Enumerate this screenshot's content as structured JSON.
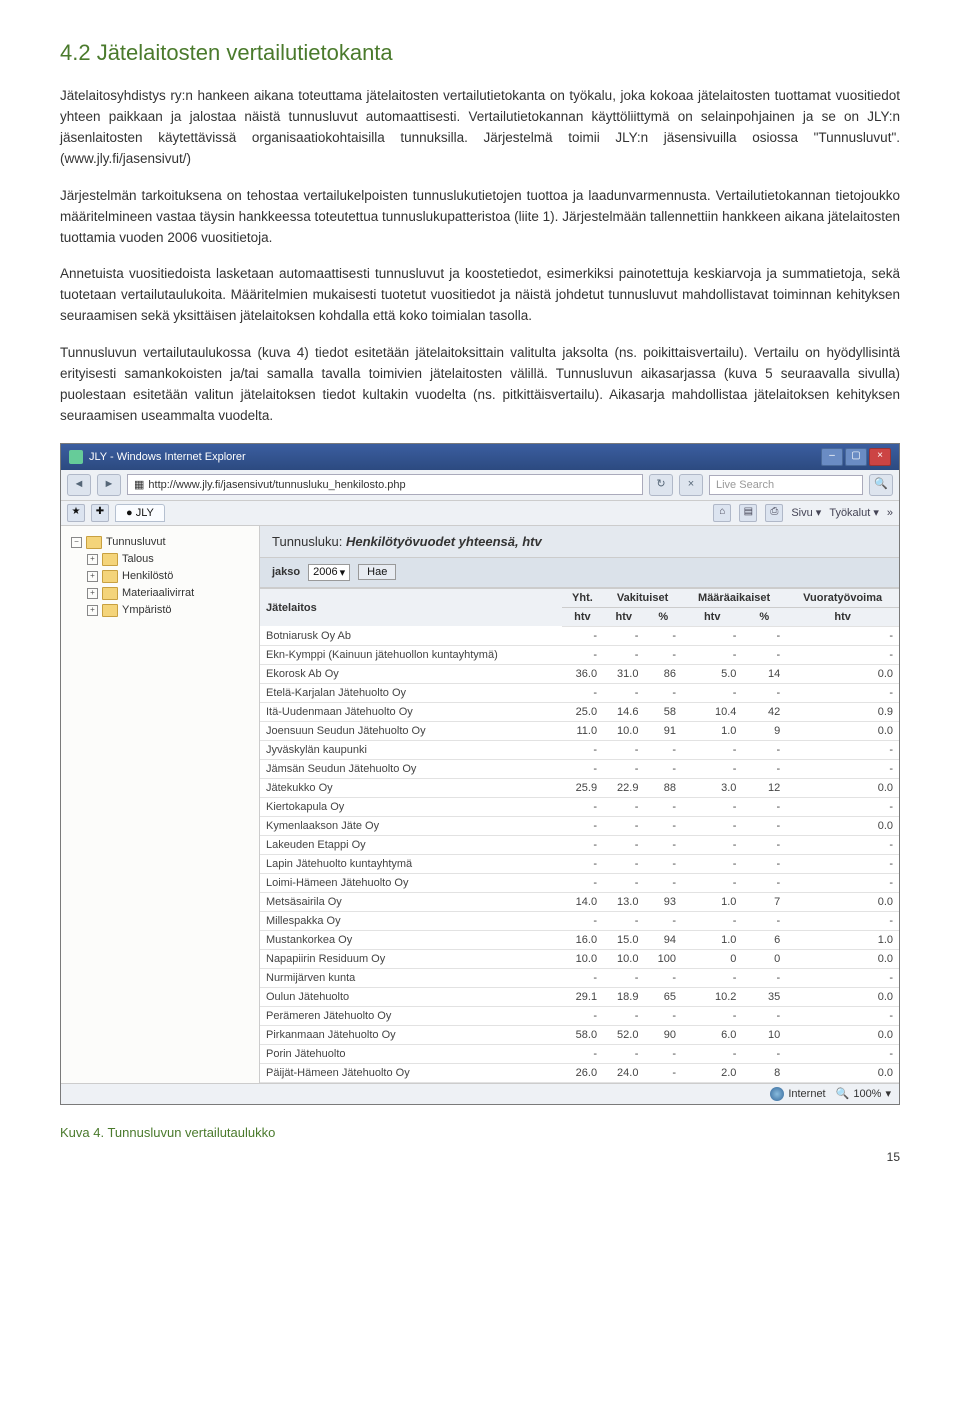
{
  "section_heading": "4.2 Jätelaitosten vertailutietokanta",
  "paragraphs": {
    "p1": "Jätelaitosyhdistys ry:n hankeen aikana toteuttama jätelaitosten vertailutietokanta on työkalu, joka kokoaa jätelaitosten tuottamat vuositiedot yhteen paikkaan ja jalostaa näistä tunnusluvut automaattisesti. Vertailutietokannan käyttöliittymä on selainpohjainen ja se on JLY:n jäsenlaitosten käytettävissä organisaatiokohtaisilla tunnuksilla. Järjestelmä toimii JLY:n jäsensivuilla osiossa \"Tunnusluvut\". (www.jly.fi/jasensivut/)",
    "p2": "Järjestelmän tarkoituksena on tehostaa vertailukelpoisten tunnuslukutietojen tuottoa ja laadunvarmennusta. Vertailutietokannan tietojoukko määritelmineen vastaa täysin hankkeessa toteutettua tunnuslukupatteristoa (liite 1). Järjestelmään tallennettiin hankkeen aikana jätelaitosten tuottamia vuoden 2006 vuositietoja.",
    "p3": "Annetuista vuositiedoista lasketaan automaattisesti tunnusluvut ja koostetiedot, esimerkiksi painotettuja keskiarvoja ja summatietoja, sekä tuotetaan vertailutaulukoita. Määritelmien mukaisesti tuotetut vuositiedot ja näistä johdetut tunnusluvut mahdollistavat toiminnan kehityksen seuraamisen sekä yksittäisen jätelaitoksen kohdalla että koko toimialan tasolla.",
    "p4": "Tunnusluvun vertailutaulukossa (kuva 4) tiedot esitetään jätelaitoksittain valitulta jaksolta (ns. poikittaisvertailu). Vertailu on hyödyllisintä erityisesti samankokoisten ja/tai samalla tavalla toimivien jätelaitosten välillä. Tunnusluvun aikasarjassa (kuva 5 seuraavalla sivulla) puolestaan esitetään valitun jätelaitoksen tiedot kultakin vuodelta (ns. pitkittäisvertailu). Aikasarja mahdollistaa jätelaitoksen kehityksen seuraamisen useammalta vuodelta."
  },
  "browser": {
    "title": "JLY - Windows Internet Explorer",
    "url": "http://www.jly.fi/jasensivut/tunnusluku_henkilosto.php",
    "search_placeholder": "Live Search",
    "tab_label": "JLY",
    "toolbar": {
      "sivu": "Sivu",
      "tyokalut": "Työkalut"
    },
    "tree": {
      "root": "Tunnusluvut",
      "items": [
        "Talous",
        "Henkilöstö",
        "Materiaalivirrat",
        "Ympäristö"
      ]
    },
    "panel": {
      "label_prefix": "Tunnusluku:",
      "label_value": "Henkilötyövuodet yhteensä, htv",
      "filter_label": "jakso",
      "year": "2006",
      "hae": "Hae"
    },
    "status": {
      "zone": "Internet",
      "zoom": "100%"
    }
  },
  "chart_data": {
    "type": "table",
    "title": "Henkilötyövuodet yhteensä, htv",
    "columns_top": [
      "",
      "Yht.",
      "Vakituiset",
      "Määräaikaiset",
      "Vuoratyövoima"
    ],
    "columns_sub": [
      "Jätelaitos",
      "htv",
      "htv",
      "%",
      "htv",
      "%",
      "htv"
    ],
    "rows": [
      {
        "name": "Botniarusk Oy Ab",
        "yht": "-",
        "vak_htv": "-",
        "vak_pct": "-",
        "maa_htv": "-",
        "maa_pct": "-",
        "vuo": "-"
      },
      {
        "name": "Ekn-Kymppi (Kainuun jätehuollon kuntayhtymä)",
        "yht": "-",
        "vak_htv": "-",
        "vak_pct": "-",
        "maa_htv": "-",
        "maa_pct": "-",
        "vuo": "-"
      },
      {
        "name": "Ekorosk Ab Oy",
        "yht": "36.0",
        "vak_htv": "31.0",
        "vak_pct": "86",
        "maa_htv": "5.0",
        "maa_pct": "14",
        "vuo": "0.0"
      },
      {
        "name": "Etelä-Karjalan Jätehuolto Oy",
        "yht": "-",
        "vak_htv": "-",
        "vak_pct": "-",
        "maa_htv": "-",
        "maa_pct": "-",
        "vuo": "-"
      },
      {
        "name": "Itä-Uudenmaan Jätehuolto Oy",
        "yht": "25.0",
        "vak_htv": "14.6",
        "vak_pct": "58",
        "maa_htv": "10.4",
        "maa_pct": "42",
        "vuo": "0.9"
      },
      {
        "name": "Joensuun Seudun Jätehuolto Oy",
        "yht": "11.0",
        "vak_htv": "10.0",
        "vak_pct": "91",
        "maa_htv": "1.0",
        "maa_pct": "9",
        "vuo": "0.0"
      },
      {
        "name": "Jyväskylän kaupunki",
        "yht": "-",
        "vak_htv": "-",
        "vak_pct": "-",
        "maa_htv": "-",
        "maa_pct": "-",
        "vuo": "-"
      },
      {
        "name": "Jämsän Seudun Jätehuolto Oy",
        "yht": "-",
        "vak_htv": "-",
        "vak_pct": "-",
        "maa_htv": "-",
        "maa_pct": "-",
        "vuo": "-"
      },
      {
        "name": "Jätekukko Oy",
        "yht": "25.9",
        "vak_htv": "22.9",
        "vak_pct": "88",
        "maa_htv": "3.0",
        "maa_pct": "12",
        "vuo": "0.0"
      },
      {
        "name": "Kiertokapula Oy",
        "yht": "-",
        "vak_htv": "-",
        "vak_pct": "-",
        "maa_htv": "-",
        "maa_pct": "-",
        "vuo": "-"
      },
      {
        "name": "Kymenlaakson Jäte Oy",
        "yht": "-",
        "vak_htv": "-",
        "vak_pct": "-",
        "maa_htv": "-",
        "maa_pct": "-",
        "vuo": "0.0"
      },
      {
        "name": "Lakeuden Etappi Oy",
        "yht": "-",
        "vak_htv": "-",
        "vak_pct": "-",
        "maa_htv": "-",
        "maa_pct": "-",
        "vuo": "-"
      },
      {
        "name": "Lapin Jätehuolto kuntayhtymä",
        "yht": "-",
        "vak_htv": "-",
        "vak_pct": "-",
        "maa_htv": "-",
        "maa_pct": "-",
        "vuo": "-"
      },
      {
        "name": "Loimi-Hämeen Jätehuolto Oy",
        "yht": "-",
        "vak_htv": "-",
        "vak_pct": "-",
        "maa_htv": "-",
        "maa_pct": "-",
        "vuo": "-"
      },
      {
        "name": "Metsäsairila Oy",
        "yht": "14.0",
        "vak_htv": "13.0",
        "vak_pct": "93",
        "maa_htv": "1.0",
        "maa_pct": "7",
        "vuo": "0.0"
      },
      {
        "name": "Millespakka Oy",
        "yht": "-",
        "vak_htv": "-",
        "vak_pct": "-",
        "maa_htv": "-",
        "maa_pct": "-",
        "vuo": "-"
      },
      {
        "name": "Mustankorkea Oy",
        "yht": "16.0",
        "vak_htv": "15.0",
        "vak_pct": "94",
        "maa_htv": "1.0",
        "maa_pct": "6",
        "vuo": "1.0"
      },
      {
        "name": "Napapiirin Residuum Oy",
        "yht": "10.0",
        "vak_htv": "10.0",
        "vak_pct": "100",
        "maa_htv": "0",
        "maa_pct": "0",
        "vuo": "0.0"
      },
      {
        "name": "Nurmijärven kunta",
        "yht": "-",
        "vak_htv": "-",
        "vak_pct": "-",
        "maa_htv": "-",
        "maa_pct": "-",
        "vuo": "-"
      },
      {
        "name": "Oulun Jätehuolto",
        "yht": "29.1",
        "vak_htv": "18.9",
        "vak_pct": "65",
        "maa_htv": "10.2",
        "maa_pct": "35",
        "vuo": "0.0"
      },
      {
        "name": "Perämeren Jätehuolto Oy",
        "yht": "-",
        "vak_htv": "-",
        "vak_pct": "-",
        "maa_htv": "-",
        "maa_pct": "-",
        "vuo": "-"
      },
      {
        "name": "Pirkanmaan Jätehuolto Oy",
        "yht": "58.0",
        "vak_htv": "52.0",
        "vak_pct": "90",
        "maa_htv": "6.0",
        "maa_pct": "10",
        "vuo": "0.0"
      },
      {
        "name": "Porin Jätehuolto",
        "yht": "-",
        "vak_htv": "-",
        "vak_pct": "-",
        "maa_htv": "-",
        "maa_pct": "-",
        "vuo": "-"
      },
      {
        "name": "Päijät-Hämeen Jätehuolto Oy",
        "yht": "26.0",
        "vak_htv": "24.0",
        "vak_pct": "-",
        "maa_htv": "2.0",
        "maa_pct": "8",
        "vuo": "0.0"
      }
    ]
  },
  "figure_caption": "Kuva 4. Tunnusluvun vertailutaulukko",
  "page_number": "15"
}
